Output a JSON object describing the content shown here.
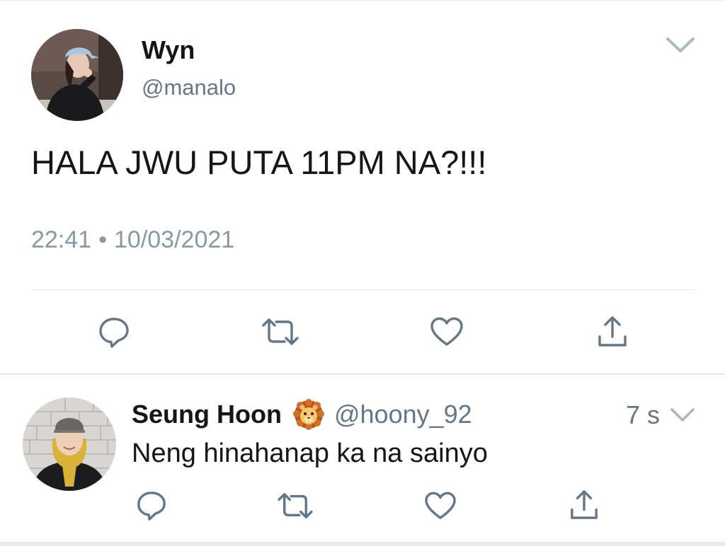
{
  "tweet": {
    "author_name": "Wyn",
    "author_handle": "@manalo",
    "text": "HALA JWU PUTA 11PM NA?!!!",
    "time": "22:41",
    "separator": "•",
    "date": "10/03/2021",
    "actions": [
      "reply-icon",
      "retweet-icon",
      "like-icon",
      "share-icon"
    ]
  },
  "reply": {
    "author_name": "Seung Hoon",
    "badge_icon": "lion-emoji",
    "author_handle": "@hoony_92",
    "time_ago": "7 s",
    "text": "Neng hinahanap ka na sainyo",
    "actions": [
      "reply-icon",
      "retweet-icon",
      "like-icon",
      "share-icon"
    ]
  },
  "colors": {
    "text_primary": "#14171a",
    "text_secondary": "#657786",
    "icon_gray": "#657786",
    "divider": "#e1e8ed"
  }
}
